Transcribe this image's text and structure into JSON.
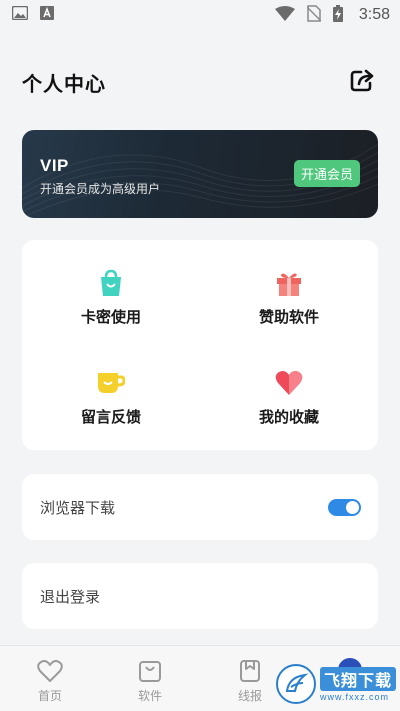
{
  "status_bar": {
    "time": "3:58",
    "icons": [
      "image-icon",
      "font-a-icon",
      "wifi-icon",
      "no-sim-icon",
      "battery-charging-icon"
    ]
  },
  "header": {
    "title": "个人中心",
    "share_icon": "share-icon"
  },
  "vip_card": {
    "title": "VIP",
    "subtitle": "开通会员成为高级用户",
    "button_label": "开通会员"
  },
  "grid": {
    "items": [
      {
        "label": "卡密使用",
        "icon": "shopping-bag-icon",
        "color": "#3fd3c0"
      },
      {
        "label": "赞助软件",
        "icon": "gift-icon",
        "color": "#f0645f"
      },
      {
        "label": "留言反馈",
        "icon": "coffee-cup-icon",
        "color": "#f5cf2a"
      },
      {
        "label": "我的收藏",
        "icon": "heart-icon",
        "color": "#ef4a5a"
      }
    ]
  },
  "settings": {
    "browser_download_label": "浏览器下载",
    "browser_download_enabled": true,
    "logout_label": "退出登录"
  },
  "tab_bar": {
    "tabs": [
      {
        "label": "首页",
        "icon": "heart-outline-icon"
      },
      {
        "label": "软件",
        "icon": "bag-outline-icon"
      },
      {
        "label": "线报",
        "icon": "bookmark-outline-icon"
      },
      {
        "label": "",
        "icon": "profile-icon",
        "active": true
      }
    ]
  },
  "watermark": {
    "main": "飞翔下载",
    "sub": "www.fxxz.com"
  },
  "colors": {
    "background": "#f3f4f6",
    "vip_button": "#4fc77c",
    "toggle_on": "#2f8ae6"
  }
}
